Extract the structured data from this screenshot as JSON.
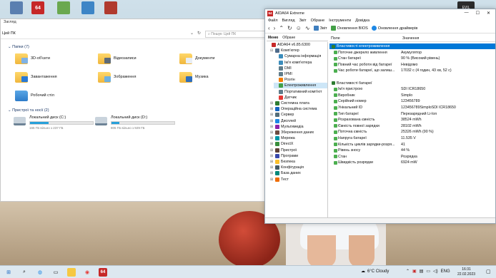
{
  "explorer": {
    "ribbon_label": "Загляд",
    "address": "Цей ПК",
    "search_placeholder": "Пошук: Цей ПК",
    "folders_header": "Папки (7)",
    "folders": [
      {
        "label": "3D-об'єкти"
      },
      {
        "label": "Відеозаписи"
      },
      {
        "label": "Документи"
      },
      {
        "label": "Завантаження"
      },
      {
        "label": "Зображення"
      },
      {
        "label": "Музика"
      },
      {
        "label": "Робочий стіл"
      }
    ],
    "devices_header": "Пристрої та носії (2)",
    "drives": [
      {
        "label": "Локальний диск (C:)",
        "free": "165 ГБ вільно з 237 ГБ",
        "used_fraction": 0.3
      },
      {
        "label": "Локальний диск (D:)",
        "free": "805 ГБ вільно з 929 ГБ",
        "used_fraction": 0.13
      }
    ]
  },
  "aida": {
    "title": "AIDA64 Extreme",
    "app_icon_text": "64",
    "menu": [
      "Файл",
      "Вигляд",
      "Звіт",
      "Обране",
      "Інструменти",
      "Довідка"
    ],
    "toolbar": {
      "report": "Звіт",
      "bios_update": "Оновлення BIOS",
      "driver_update": "Оновлення драйверів"
    },
    "tabs": {
      "menu": "Меню",
      "favorites": "Обране"
    },
    "tree": [
      {
        "label": "AIDA64 v6.85.6300",
        "level": 0,
        "color": "#c62828"
      },
      {
        "label": "Комп'ютер",
        "level": 1,
        "color": "#4f6b8a",
        "exp": "⊟"
      },
      {
        "label": "Сумарна інформація",
        "level": 2,
        "color": "#3c8dbc"
      },
      {
        "label": "Ім'я комп'ютера",
        "level": 2,
        "color": "#3c8dbc"
      },
      {
        "label": "DMI",
        "level": 2,
        "color": "#607d8b"
      },
      {
        "label": "IPMI",
        "level": 2,
        "color": "#607d8b"
      },
      {
        "label": "Розгін",
        "level": 2,
        "color": "#f57c00"
      },
      {
        "label": "Електроживлення",
        "level": 2,
        "color": "#43a047",
        "selected": true
      },
      {
        "label": "Портативний комп'ют",
        "level": 2,
        "color": "#607d8b"
      },
      {
        "label": "Датчик",
        "level": 2,
        "color": "#e53935"
      },
      {
        "label": "Системна плата",
        "level": 1,
        "color": "#2e7d32",
        "exp": "⊞"
      },
      {
        "label": "Операційна система",
        "level": 1,
        "color": "#1565c0",
        "exp": "⊞"
      },
      {
        "label": "Сервер",
        "level": 1,
        "color": "#546e7a",
        "exp": "⊞"
      },
      {
        "label": "Дисплей",
        "level": 1,
        "color": "#1e88e5",
        "exp": "⊞"
      },
      {
        "label": "Мультимедіа",
        "level": 1,
        "color": "#8e24aa",
        "exp": "⊞"
      },
      {
        "label": "Збереження даних",
        "level": 1,
        "color": "#6d4c41",
        "exp": "⊞"
      },
      {
        "label": "Мережа",
        "level": 1,
        "color": "#0097a7",
        "exp": "⊞"
      },
      {
        "label": "DirectX",
        "level": 1,
        "color": "#388e3c",
        "exp": "⊞"
      },
      {
        "label": "Пристрої",
        "level": 1,
        "color": "#5d4037",
        "exp": "⊞"
      },
      {
        "label": "Програми",
        "level": 1,
        "color": "#3949ab",
        "exp": "⊞"
      },
      {
        "label": "Безпека",
        "level": 1,
        "color": "#fbc02d",
        "exp": "⊞"
      },
      {
        "label": "Конфігурація",
        "level": 1,
        "color": "#455a64",
        "exp": "⊞"
      },
      {
        "label": "База даних",
        "level": 1,
        "color": "#00897b",
        "exp": "⊞"
      },
      {
        "label": "Тест",
        "level": 1,
        "color": "#ef6c00",
        "exp": "⊞"
      }
    ],
    "columns": {
      "field": "Поле",
      "value": "Значення"
    },
    "rows": [
      {
        "field": "Властивості електроживлення",
        "value": "",
        "section": true,
        "highlight": true
      },
      {
        "field": "Поточне джерело живлення",
        "value": "Акумулятор"
      },
      {
        "field": "Стан батареї",
        "value": "90 % (Високий рівень)"
      },
      {
        "field": "Повний час роботи від батареї",
        "value": "Невідомо"
      },
      {
        "field": "Час роботи батареї, що залиш...",
        "value": "17032 с (4 годин, 43 хв, 52 с)"
      },
      {
        "field": "",
        "value": "",
        "blank": true
      },
      {
        "field": "Властивості батареї",
        "value": "",
        "section": true
      },
      {
        "field": "Ім'я пристрою",
        "value": "SDI ICR18650"
      },
      {
        "field": "Виробник",
        "value": "Simplo"
      },
      {
        "field": "Серійний номер",
        "value": "123456789"
      },
      {
        "field": "Унікальний ID",
        "value": "123456789SimploSDI ICR18650"
      },
      {
        "field": "Тип батареї",
        "value": "Перезарядний Li-Ion"
      },
      {
        "field": "Розрахована ємність",
        "value": "38524 mWh"
      },
      {
        "field": "Ємність повної зарядки",
        "value": "28102 mWh"
      },
      {
        "field": "Поточна ємність",
        "value": "25326 mWh  (90 %)"
      },
      {
        "field": "Напруга батареї",
        "value": "11.535 V"
      },
      {
        "field": "Кількість циклів зарядки-розря...",
        "value": "41"
      },
      {
        "field": "Рівень зносу",
        "value": "44 %"
      },
      {
        "field": "Стан",
        "value": "Розрядка"
      },
      {
        "field": "Швидкість розрядки",
        "value": "6924 mW"
      }
    ]
  },
  "taskbar": {
    "weather": "6°C  Cloudy",
    "language": "ENG",
    "time": "16:31",
    "date": "22.02.2023",
    "aida_icon_text": "64"
  },
  "desktop": {
    "top_icon_text": "64",
    "corner_text": "EVIL"
  }
}
